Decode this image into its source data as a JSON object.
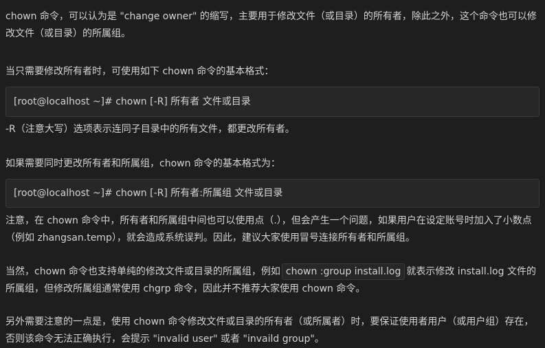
{
  "paragraphs": {
    "p1": "chown 命令，可以认为是 \"change owner\" 的缩写，主要用于修改文件（或目录）的所有者，除此之外，这个命令也可以修改文件（或目录）的所属组。",
    "p2": "当只需要修改所有者时，可使用如下 chown 命令的基本格式：",
    "p3": "-R（注意大写）选项表示连同子目录中的所有文件，都更改所有者。",
    "p4": "如果需要同时更改所有者和所属组，chown 命令的基本格式为：",
    "p5": "注意，在 chown 命令中，所有者和所属组中间也可以使用点（.），但会产生一个问题，如果用户在设定账号时加入了小数点（例如 zhangsan.temp），就会造成系统误判。因此，建议大家使用冒号连接所有者和所属组。",
    "p6_before": "当然，chown 命令也支持单纯的修改文件或目录的所属组，例如",
    "p6_code": "chown :group install.log",
    "p6_after": "就表示修改 install.log 文件的所属组，但修改所属组通常使用 chgrp 命令，因此并不推荐大家使用 chown 命令。",
    "p7": "另外需要注意的一点是，使用 chown 命令修改文件或目录的所有者（或所属者）时，要保证使用者用户（或用户组）存在，否则该命令无法正确执行，会提示 \"invalid user\" 或者 \"invaild group\"。"
  },
  "code_blocks": {
    "owner_only": "[root@localhost ~]# chown [-R] 所有者 文件或目录",
    "owner_group": "[root@localhost ~]# chown [-R] 所有者:所属组 文件或目录"
  }
}
